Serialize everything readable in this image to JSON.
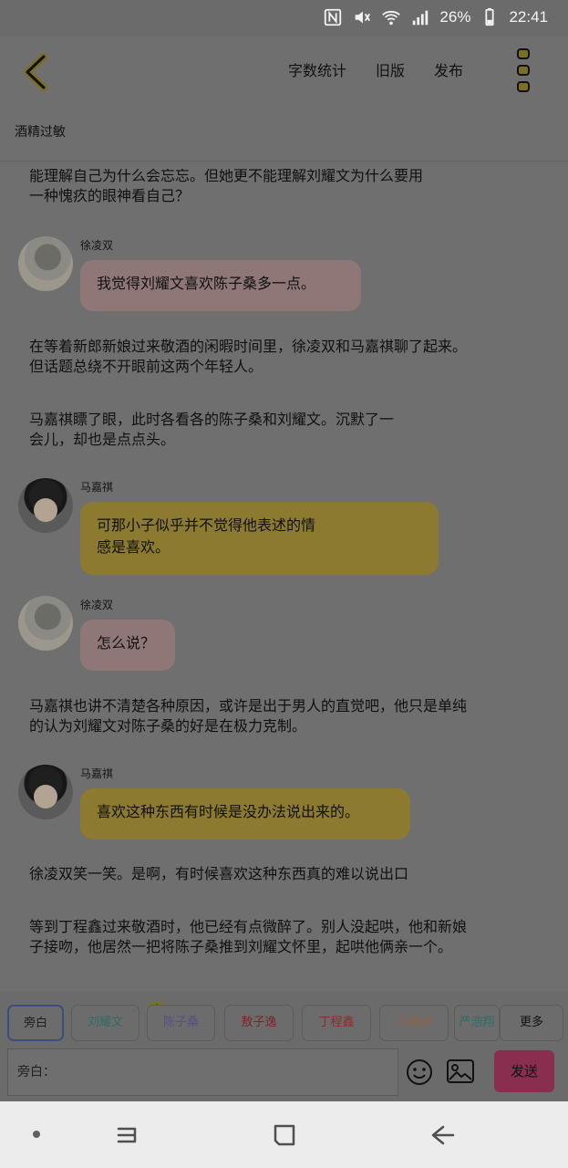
{
  "status": {
    "battery": "26%",
    "time": "22:41",
    "icons": [
      "nfc-icon",
      "mute-icon",
      "wifi-icon",
      "signal-icon"
    ]
  },
  "toolbar": {
    "word_count": "字数统计",
    "old_version": "旧版",
    "publish": "发布"
  },
  "chapter": {
    "title": "酒精过敏"
  },
  "content": {
    "top_paragraph_line1": "能理解自己为什么会忘忘。但她更不能理解刘耀文为什么要用",
    "top_paragraph_line2": "一种愧疚的眼神看自己？",
    "messages": [
      {
        "speaker": "徐凌双",
        "text": "我觉得刘耀文喜欢陈子桑多一点。"
      },
      {
        "speaker": "马嘉祺",
        "text_line1": "可那小子似乎并不觉得他表述的情",
        "text_line2": "感是喜欢。"
      },
      {
        "speaker": "徐凌双",
        "text": "怎么说？"
      },
      {
        "speaker": "马嘉祺",
        "text": "喜欢这种东西有时候是没办法说出来的。"
      }
    ],
    "narration1_line1": "在等着新郎新娘过来敬酒的闲暇时间里，徐凌双和马嘉祺聊了起来。",
    "narration1_line2": "但话题总绕不开眼前这两个年轻人。",
    "narration2_line1": "马嘉祺瞟了眼，此时各看各的陈子桑和刘耀文。沉默了一",
    "narration2_line2": "会儿，却也是点点头。",
    "narration3_line1": "马嘉祺也讲不清楚各种原因，或许是出于男人的直觉吧，他只是单纯",
    "narration3_line2": "的认为刘耀文对陈子桑的好是在极力克制。",
    "narration4": "徐凌双笑一笑。是啊，有时候喜欢这种东西真的难以说出口",
    "narration5_line1": "等到丁程鑫过来敬酒时，他已经有点微醉了。别人没起哄，他和新娘",
    "narration5_line2": "子接吻，他居然一把将陈子桑推到刘耀文怀里，起哄他俩亲一个。"
  },
  "composer": {
    "characters": [
      {
        "name": "旁白",
        "color": "#1e1e1e"
      },
      {
        "name": "刘耀文",
        "color": "#2f6d67"
      },
      {
        "name": "陈子桑",
        "color": "#5b4c8a"
      },
      {
        "name": "敖子逸",
        "color": "#7b2424"
      },
      {
        "name": "丁程鑫",
        "color": "#8b2c2c"
      },
      {
        "name": "马嘉祺",
        "color": "#8c654a"
      },
      {
        "name": "严浩翔",
        "color": "#2f6d67"
      }
    ],
    "main_badge": "主",
    "more": "更多",
    "input_placeholder": "旁白：",
    "send": "发送"
  }
}
